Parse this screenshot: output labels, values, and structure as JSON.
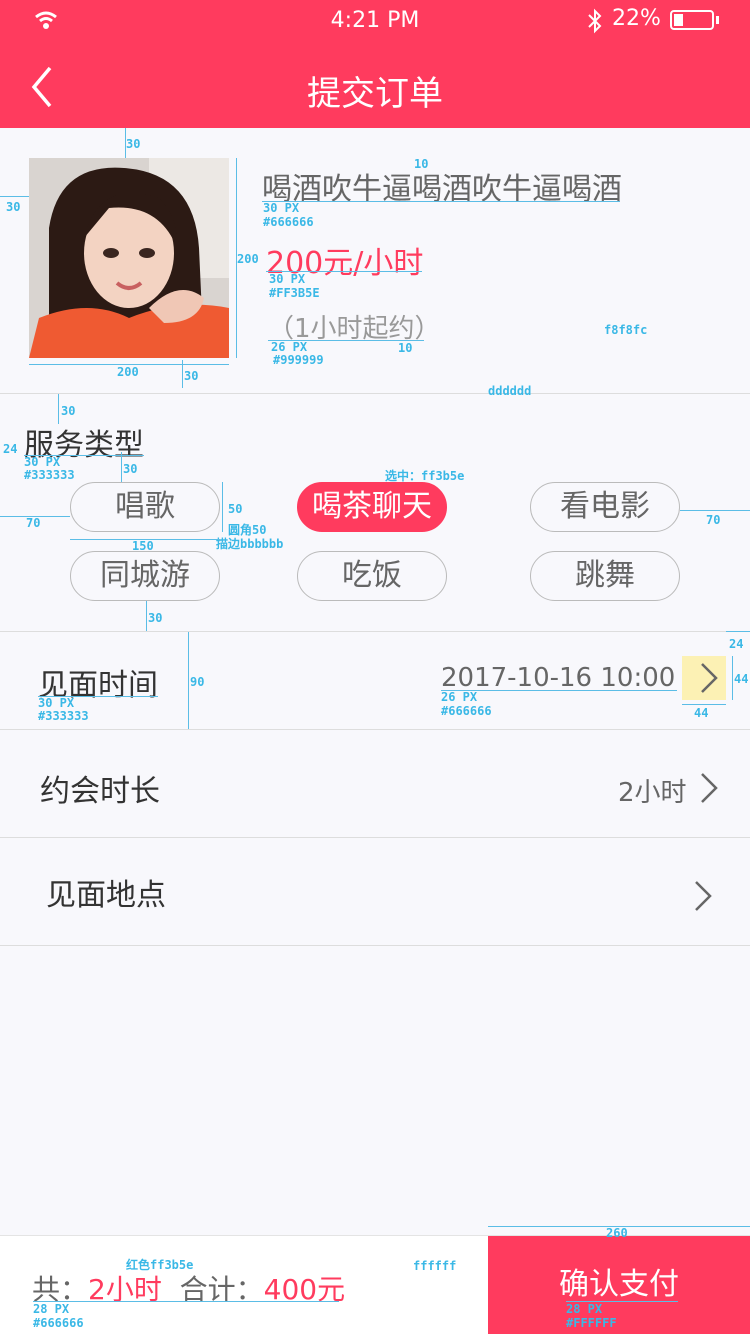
{
  "status_bar": {
    "time": "4:21 PM",
    "battery": "22%"
  },
  "header": {
    "title": "提交订单"
  },
  "product": {
    "name": "喝酒吹牛逼喝酒吹牛逼喝酒",
    "price": "200元/小时",
    "min_note": "（1小时起约）"
  },
  "service": {
    "title": "服务类型",
    "options": [
      "唱歌",
      "喝茶聊天",
      "看电影",
      "同城游",
      "吃饭",
      "跳舞"
    ],
    "selected": "喝茶聊天"
  },
  "rows": {
    "meet_time": {
      "label": "见面时间",
      "value": "2017-10-16  10:00"
    },
    "duration": {
      "label": "约会时长",
      "value": "2小时"
    },
    "location": {
      "label": "见面地点"
    }
  },
  "footer": {
    "total_prefix": "共：",
    "hours": "2小时",
    "sum_prefix": "合计：",
    "amount": "400元",
    "pay_button": "确认支付"
  },
  "annotations": {
    "top_gap": "30",
    "left_gap": "30",
    "gap10a": "10",
    "name_size": "30  PX",
    "name_color": "#666666",
    "img_h": "200",
    "price_size": "30 PX",
    "price_color": "#FF3B5E",
    "bg_color": "f8f8fc",
    "note_size": "26 PX",
    "note_color": "#999999",
    "gap10b": "10",
    "img_w": "200",
    "gap30b": "30",
    "div_color": "dddddd",
    "gap30c": "30",
    "gap24": "24",
    "svc_size": "30 PX",
    "svc_color": "#333333",
    "gap30d": "30",
    "selected_note": "选中：ff3b5e",
    "chip_h": "50",
    "chip_radius": "圆角50",
    "chip_border": "描边bbbbbb",
    "chip_left": "70",
    "chip_w": "150",
    "chip_right": "70",
    "gap30e": "30",
    "row_h": "90",
    "row_label_size": "30 PX",
    "row_label_color": "#333333",
    "row_val_size": "26 PX",
    "row_val_color": "#666666",
    "arrow_gap": "24",
    "arrow_h": "44",
    "arrow_w": "44",
    "red_color": "红色ff3b5e",
    "white_color": "ffffff",
    "pay_w": "260",
    "total_size": "28 PX",
    "total_color": "#666666",
    "pay_size": "28 PX",
    "pay_color": "#FFFFFF"
  }
}
